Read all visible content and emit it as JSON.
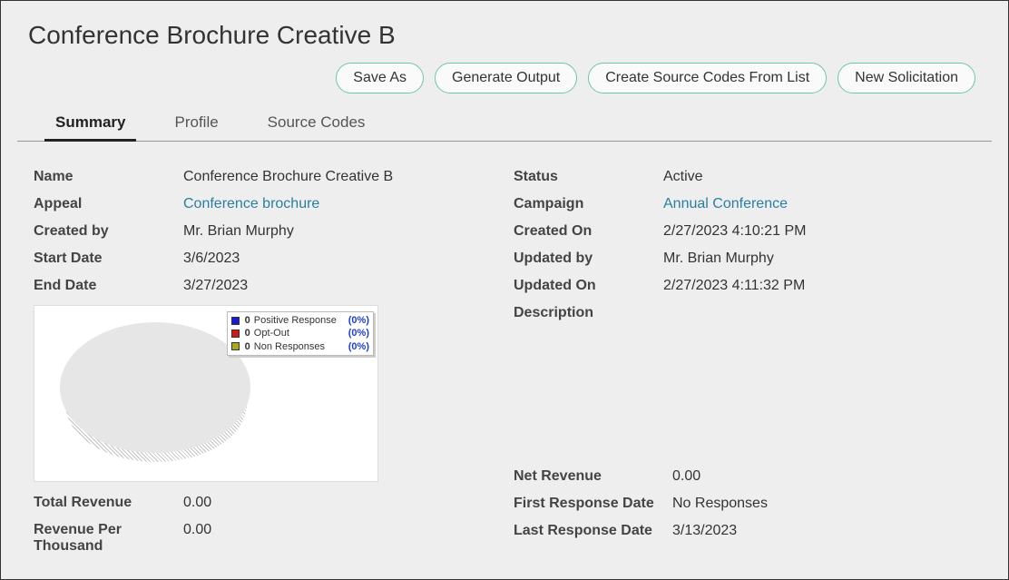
{
  "page_title": "Conference Brochure Creative B",
  "actions": {
    "save_as": "Save As",
    "generate_output": "Generate Output",
    "create_source_codes": "Create Source Codes From List",
    "new_solicitation": "New Solicitation"
  },
  "tabs": {
    "summary": "Summary",
    "profile": "Profile",
    "source_codes": "Source Codes"
  },
  "left": {
    "name_label": "Name",
    "name_value": "Conference Brochure Creative B",
    "appeal_label": "Appeal",
    "appeal_value": "Conference brochure",
    "created_by_label": "Created by",
    "created_by_value": "Mr. Brian Murphy",
    "start_date_label": "Start Date",
    "start_date_value": "3/6/2023",
    "end_date_label": "End Date",
    "end_date_value": "3/27/2023",
    "total_revenue_label": "Total Revenue",
    "total_revenue_value": "0.00",
    "rev_per_k_label_1": "Revenue Per",
    "rev_per_k_label_2": "Thousand",
    "rev_per_k_value": "0.00"
  },
  "right": {
    "status_label": "Status",
    "status_value": "Active",
    "campaign_label": "Campaign",
    "campaign_value": "Annual Conference",
    "created_on_label": "Created On",
    "created_on_value": "2/27/2023 4:10:21 PM",
    "updated_by_label": "Updated by",
    "updated_by_value": "Mr. Brian Murphy",
    "updated_on_label": "Updated On",
    "updated_on_value": "2/27/2023 4:11:32 PM",
    "description_label": "Description",
    "net_revenue_label": "Net Revenue",
    "net_revenue_value": "0.00",
    "first_resp_label": "First Response Date",
    "first_resp_value": "No Responses",
    "last_resp_label": "Last Response Date",
    "last_resp_value": "3/13/2023"
  },
  "chart_data": {
    "type": "pie",
    "title": "",
    "series": [
      {
        "name": "Positive Response",
        "value": 0,
        "pct": "(0%)",
        "color": "#1a1ad6"
      },
      {
        "name": "Opt-Out",
        "value": 0,
        "pct": "(0%)",
        "color": "#d01a1a"
      },
      {
        "name": "Non Responses",
        "value": 0,
        "pct": "(0%)",
        "color": "#a8a81a"
      }
    ]
  }
}
